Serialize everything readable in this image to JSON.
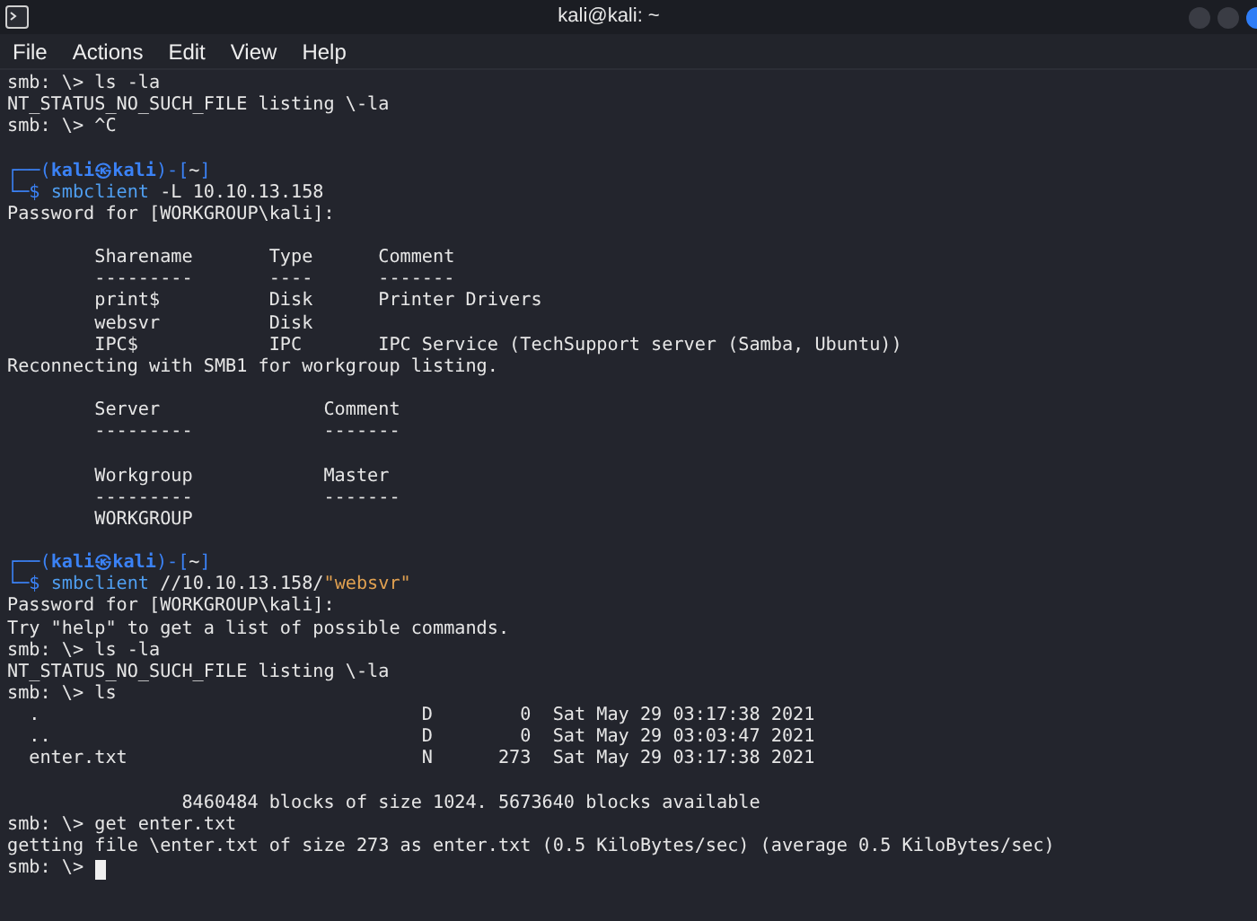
{
  "window": {
    "title": "kali@kali: ~"
  },
  "menu": [
    "File",
    "Actions",
    "Edit",
    "View",
    "Help"
  ],
  "lines": [
    {
      "kind": "text",
      "parts": [
        {
          "kind": "plain",
          "text": "smb: \\> ls -la"
        }
      ]
    },
    {
      "kind": "text",
      "parts": [
        {
          "kind": "plain",
          "text": "NT_STATUS_NO_SUCH_FILE listing \\-la"
        }
      ]
    },
    {
      "kind": "text",
      "parts": [
        {
          "kind": "plain",
          "text": "smb: \\> ^C"
        }
      ]
    },
    {
      "kind": "blank"
    },
    {
      "kind": "text",
      "parts": [
        {
          "kind": "frame",
          "text": "┌──("
        },
        {
          "kind": "prompt",
          "text": "kali㉿kali"
        },
        {
          "kind": "frame",
          "text": ")-["
        },
        {
          "kind": "plain",
          "text": "~"
        },
        {
          "kind": "frame",
          "text": "]"
        }
      ]
    },
    {
      "kind": "text",
      "parts": [
        {
          "kind": "frame",
          "text": "└─$ "
        },
        {
          "kind": "command",
          "text": "smbclient"
        },
        {
          "kind": "plain",
          "text": " -L 10.10.13.158"
        }
      ]
    },
    {
      "kind": "text",
      "parts": [
        {
          "kind": "plain",
          "text": "Password for [WORKGROUP\\kali]:"
        }
      ]
    },
    {
      "kind": "blank"
    },
    {
      "kind": "text",
      "parts": [
        {
          "kind": "plain",
          "text": "        Sharename       Type      Comment"
        }
      ]
    },
    {
      "kind": "text",
      "parts": [
        {
          "kind": "plain",
          "text": "        ---------       ----      -------"
        }
      ]
    },
    {
      "kind": "text",
      "parts": [
        {
          "kind": "plain",
          "text": "        print$          Disk      Printer Drivers"
        }
      ]
    },
    {
      "kind": "text",
      "parts": [
        {
          "kind": "plain",
          "text": "        websvr          Disk"
        }
      ]
    },
    {
      "kind": "text",
      "parts": [
        {
          "kind": "plain",
          "text": "        IPC$            IPC       IPC Service (TechSupport server (Samba, Ubuntu))"
        }
      ]
    },
    {
      "kind": "text",
      "parts": [
        {
          "kind": "plain",
          "text": "Reconnecting with SMB1 for workgroup listing."
        }
      ]
    },
    {
      "kind": "blank"
    },
    {
      "kind": "text",
      "parts": [
        {
          "kind": "plain",
          "text": "        Server               Comment"
        }
      ]
    },
    {
      "kind": "text",
      "parts": [
        {
          "kind": "plain",
          "text": "        ---------            -------"
        }
      ]
    },
    {
      "kind": "blank"
    },
    {
      "kind": "text",
      "parts": [
        {
          "kind": "plain",
          "text": "        Workgroup            Master"
        }
      ]
    },
    {
      "kind": "text",
      "parts": [
        {
          "kind": "plain",
          "text": "        ---------            -------"
        }
      ]
    },
    {
      "kind": "text",
      "parts": [
        {
          "kind": "plain",
          "text": "        WORKGROUP"
        }
      ]
    },
    {
      "kind": "blank"
    },
    {
      "kind": "text",
      "parts": [
        {
          "kind": "frame",
          "text": "┌──("
        },
        {
          "kind": "prompt",
          "text": "kali㉿kali"
        },
        {
          "kind": "frame",
          "text": ")-["
        },
        {
          "kind": "plain",
          "text": "~"
        },
        {
          "kind": "frame",
          "text": "]"
        }
      ]
    },
    {
      "kind": "text",
      "parts": [
        {
          "kind": "frame",
          "text": "└─$ "
        },
        {
          "kind": "command",
          "text": "smbclient"
        },
        {
          "kind": "plain",
          "text": " //10.10.13.158/"
        },
        {
          "kind": "string",
          "text": "\"websvr\""
        }
      ]
    },
    {
      "kind": "text",
      "parts": [
        {
          "kind": "plain",
          "text": "Password for [WORKGROUP\\kali]:"
        }
      ]
    },
    {
      "kind": "text",
      "parts": [
        {
          "kind": "plain",
          "text": "Try \"help\" to get a list of possible commands."
        }
      ]
    },
    {
      "kind": "text",
      "parts": [
        {
          "kind": "plain",
          "text": "smb: \\> ls -la"
        }
      ]
    },
    {
      "kind": "text",
      "parts": [
        {
          "kind": "plain",
          "text": "NT_STATUS_NO_SUCH_FILE listing \\-la"
        }
      ]
    },
    {
      "kind": "text",
      "parts": [
        {
          "kind": "plain",
          "text": "smb: \\> ls"
        }
      ]
    },
    {
      "kind": "text",
      "parts": [
        {
          "kind": "plain",
          "text": "  .                                   D        0  Sat May 29 03:17:38 2021"
        }
      ]
    },
    {
      "kind": "text",
      "parts": [
        {
          "kind": "plain",
          "text": "  ..                                  D        0  Sat May 29 03:03:47 2021"
        }
      ]
    },
    {
      "kind": "text",
      "parts": [
        {
          "kind": "plain",
          "text": "  enter.txt                           N      273  Sat May 29 03:17:38 2021"
        }
      ]
    },
    {
      "kind": "blank"
    },
    {
      "kind": "text",
      "parts": [
        {
          "kind": "plain",
          "text": "                8460484 blocks of size 1024. 5673640 blocks available"
        }
      ]
    },
    {
      "kind": "text",
      "parts": [
        {
          "kind": "plain",
          "text": "smb: \\> get enter.txt"
        }
      ]
    },
    {
      "kind": "text",
      "parts": [
        {
          "kind": "plain",
          "text": "getting file \\enter.txt of size 273 as enter.txt (0.5 KiloBytes/sec) (average 0.5 KiloBytes/sec)"
        }
      ]
    },
    {
      "kind": "text",
      "cursor": true,
      "parts": [
        {
          "kind": "plain",
          "text": "smb: \\> "
        }
      ]
    }
  ]
}
